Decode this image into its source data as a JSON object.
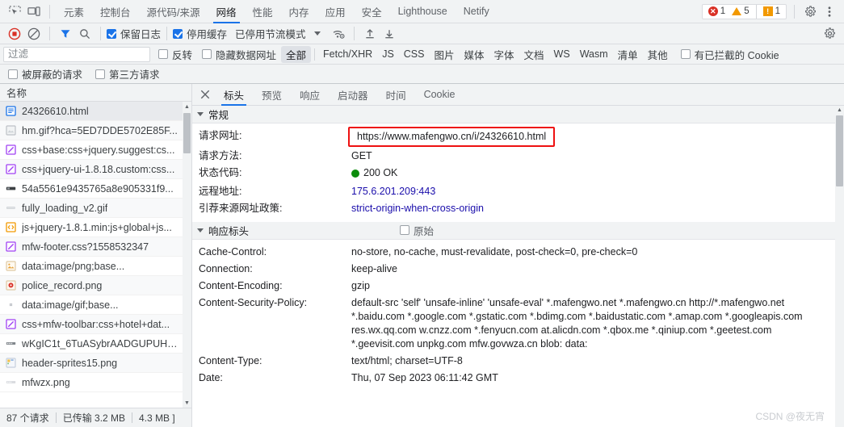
{
  "panel_tabs": [
    {
      "label": "元素",
      "selected": false
    },
    {
      "label": "控制台",
      "selected": false
    },
    {
      "label": "源代码/来源",
      "selected": false
    },
    {
      "label": "网络",
      "selected": true
    },
    {
      "label": "性能",
      "selected": false
    },
    {
      "label": "内存",
      "selected": false
    },
    {
      "label": "应用",
      "selected": false
    },
    {
      "label": "安全",
      "selected": false
    },
    {
      "label": "Lighthouse",
      "selected": false
    },
    {
      "label": "Netify",
      "selected": false
    }
  ],
  "badges": {
    "error_count": "1",
    "warning_count": "5",
    "issue_count": "1",
    "error_color": "#d93025",
    "warning_color": "#f29900"
  },
  "network_toolbar": {
    "preserve_log_label": "保留日志",
    "preserve_log_checked": true,
    "disable_cache_label": "停用缓存",
    "disable_cache_checked": true,
    "throttling_label": "已停用节流模式"
  },
  "filter_bar": {
    "placeholder": "过滤",
    "value": "",
    "invert_label": "反转",
    "invert_checked": false,
    "hide_data_urls_label": "隐藏数据网址",
    "hide_data_urls_checked": false,
    "types": [
      {
        "label": "全部",
        "selected": true
      },
      {
        "label": "Fetch/XHR",
        "selected": false
      },
      {
        "label": "JS",
        "selected": false
      },
      {
        "label": "CSS",
        "selected": false
      },
      {
        "label": "图片",
        "selected": false
      },
      {
        "label": "媒体",
        "selected": false
      },
      {
        "label": "字体",
        "selected": false
      },
      {
        "label": "文档",
        "selected": false
      },
      {
        "label": "WS",
        "selected": false
      },
      {
        "label": "Wasm",
        "selected": false
      },
      {
        "label": "清单",
        "selected": false
      },
      {
        "label": "其他",
        "selected": false
      }
    ],
    "blocked_cookies_label": "有已拦截的 Cookie",
    "blocked_cookies_checked": false,
    "blocked_requests_label": "被屏蔽的请求",
    "blocked_requests_checked": false,
    "third_party_label": "第三方请求",
    "third_party_checked": false
  },
  "request_list": {
    "column_header": "名称",
    "rows": [
      {
        "name": "24326610.html",
        "icon": "document-icon",
        "selected": true
      },
      {
        "name": "hm.gif?hca=5ED7DDE5702E85F...",
        "icon": "image-icon",
        "selected": false
      },
      {
        "name": "css+base:css+jquery.suggest:cs...",
        "icon": "stylesheet-icon",
        "selected": false
      },
      {
        "name": "css+jquery-ui-1.8.18.custom:css...",
        "icon": "stylesheet-icon",
        "selected": false
      },
      {
        "name": "54a5561e9435765a8e905331f9...",
        "icon": "font-icon",
        "selected": false
      },
      {
        "name": "fully_loading_v2.gif",
        "icon": "generic-icon",
        "selected": false
      },
      {
        "name": "js+jquery-1.8.1.min:js+global+js...",
        "icon": "script-icon",
        "selected": false
      },
      {
        "name": "mfw-footer.css?1558532347",
        "icon": "stylesheet-icon",
        "selected": false
      },
      {
        "name": "data:image/png;base...",
        "icon": "image-icon",
        "selected": false
      },
      {
        "name": "police_record.png",
        "icon": "image-icon",
        "selected": false
      },
      {
        "name": "data:image/gif;base...",
        "icon": "dot-icon",
        "selected": false
      },
      {
        "name": "css+mfw-toolbar:css+hotel+dat...",
        "icon": "stylesheet-icon",
        "selected": false
      },
      {
        "name": "wKgIC1t_6TuASybrAADGUPUHjr...",
        "icon": "font-icon",
        "selected": false
      },
      {
        "name": "header-sprites15.png",
        "icon": "image-icon",
        "selected": false
      },
      {
        "name": "mfwzx.png",
        "icon": "font-icon",
        "selected": false
      }
    ]
  },
  "status_bar": {
    "requests": "87 个请求",
    "transferred": "已传输 3.2 MB",
    "resources": "4.3 MB ]"
  },
  "detail_tabs": [
    {
      "label": "标头",
      "selected": true
    },
    {
      "label": "预览",
      "selected": false
    },
    {
      "label": "响应",
      "selected": false
    },
    {
      "label": "启动器",
      "selected": false
    },
    {
      "label": "时间",
      "selected": false
    },
    {
      "label": "Cookie",
      "selected": false
    }
  ],
  "general": {
    "section_title": "常规",
    "rows": [
      {
        "key": "请求网址:",
        "value": "https://www.mafengwo.cn/i/24326610.html",
        "style": "highlighted"
      },
      {
        "key": "请求方法:",
        "value": "GET",
        "style": "plain"
      },
      {
        "key": "状态代码:",
        "value": "200 OK",
        "style": "status-ok"
      },
      {
        "key": "远程地址:",
        "value": "175.6.201.209:443",
        "style": "link"
      },
      {
        "key": "引荐来源网址政策:",
        "value": "strict-origin-when-cross-origin",
        "style": "link"
      }
    ],
    "highlight_color": "#ee1111",
    "status_dot_color": "#0c8c0c"
  },
  "response_headers": {
    "section_title": "响应标头",
    "raw_label": "原始",
    "raw_checked": false,
    "rows": [
      {
        "key": "Cache-Control:",
        "value": "no-store, no-cache, must-revalidate, post-check=0, pre-check=0"
      },
      {
        "key": "Connection:",
        "value": "keep-alive"
      },
      {
        "key": "Content-Encoding:",
        "value": "gzip"
      },
      {
        "key": "Content-Security-Policy:",
        "value": "default-src 'self' 'unsafe-inline' 'unsafe-eval' *.mafengwo.net *.mafengwo.cn http://*.mafengwo.net *.baidu.com *.google.com *.gstatic.com *.bdimg.com *.baidustatic.com *.amap.com *.googleapis.com res.wx.qq.com w.cnzz.com *.fenyucn.com at.alicdn.com *.qbox.me *.qiniup.com *.geetest.com *.geevisit.com unpkg.com mfw.govwza.cn blob: data:"
      },
      {
        "key": "Content-Type:",
        "value": "text/html; charset=UTF-8"
      },
      {
        "key": "Date:",
        "value": "Thu, 07 Sep 2023 06:11:42 GMT"
      }
    ]
  },
  "watermark": "CSDN @夜无宵"
}
